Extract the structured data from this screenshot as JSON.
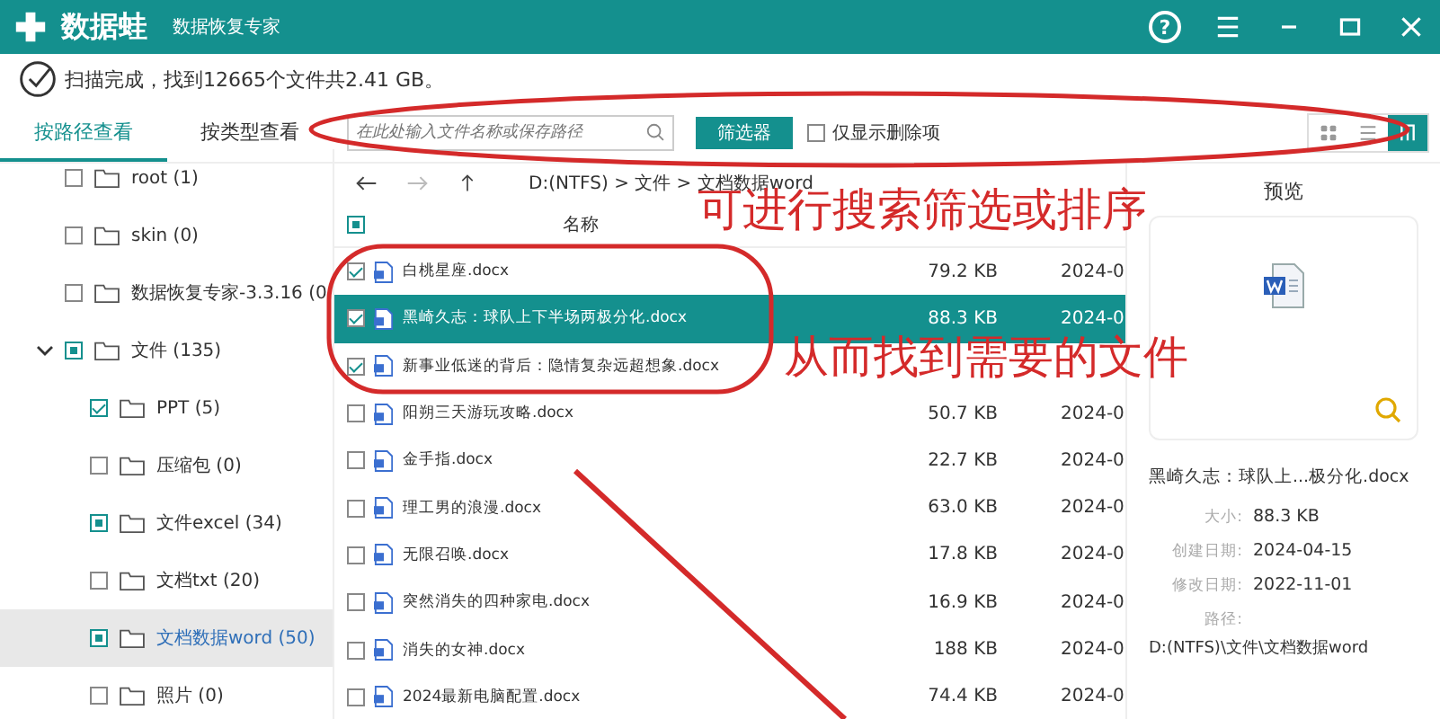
{
  "window": {
    "logo": "数据蛙",
    "subtitle": "数据恢复专家",
    "help": "?"
  },
  "status": "扫描完成，找到12665个文件共2.41 GB。",
  "tabs": [
    {
      "label": "按路径查看",
      "selected": true
    },
    {
      "label": "按类型查看",
      "selected": false
    }
  ],
  "search": {
    "placeholder": "在此处输入文件名称或保存路径"
  },
  "filter_button": "筛选器",
  "deleted_only": {
    "label": "仅显示删除项",
    "checked": false
  },
  "views": [
    {
      "kind": "grid",
      "selected": false
    },
    {
      "kind": "list",
      "selected": false
    },
    {
      "kind": "detail",
      "selected": true
    }
  ],
  "path": "D:(NTFS) > 文件 > 文档数据word",
  "tree": [
    {
      "label": "root (1)",
      "checked": false,
      "partial": false,
      "selected": false
    },
    {
      "label": "skin (0)",
      "checked": false,
      "partial": false,
      "selected": false
    },
    {
      "label": "数据恢复专家-3.3.16 (0",
      "checked": false,
      "partial": false,
      "selected": false
    },
    {
      "label": "文件 (135)",
      "checked": true,
      "partial": true,
      "selected": false,
      "expanded": true,
      "children": [
        {
          "label": "PPT (5)",
          "checked": true,
          "partial": false,
          "selected": false
        },
        {
          "label": "压缩包 (0)",
          "checked": false,
          "partial": false,
          "selected": false
        },
        {
          "label": "文件excel (34)",
          "checked": true,
          "partial": true,
          "selected": false
        },
        {
          "label": "文档txt (20)",
          "checked": false,
          "partial": false,
          "selected": false
        },
        {
          "label": "文档数据word (50)",
          "checked": true,
          "partial": true,
          "selected": true
        },
        {
          "label": "照片 (0)",
          "checked": false,
          "partial": false,
          "selected": false
        }
      ]
    }
  ],
  "table": {
    "all_checked": true,
    "all_partial": true,
    "columns": [
      "名称"
    ],
    "rows": [
      {
        "name": "白桃星座.docx",
        "size": "79.2 KB",
        "date": "2024-0",
        "checked": true,
        "selected": false
      },
      {
        "name": "黑崎久志：球队上下半场两极分化.docx",
        "size": "88.3 KB",
        "date": "2024-0",
        "checked": true,
        "selected": true
      },
      {
        "name": "新事业低迷的背后：隐情复杂远超想象.docx",
        "checked": true,
        "selected": false
      },
      {
        "name": "阳朔三天游玩攻略.docx",
        "size": "50.7 KB",
        "date": "2024-0",
        "checked": false,
        "selected": false
      },
      {
        "name": "金手指.docx",
        "size": "22.7 KB",
        "date": "2024-0",
        "checked": false,
        "selected": false
      },
      {
        "name": "理工男的浪漫.docx",
        "size": "63.0 KB",
        "date": "2024-0",
        "checked": false,
        "selected": false
      },
      {
        "name": "无限召唤.docx",
        "size": "17.8 KB",
        "date": "2024-0",
        "checked": false,
        "selected": false
      },
      {
        "name": "突然消失的四种家电.docx",
        "size": "16.9 KB",
        "date": "2024-0",
        "checked": false,
        "selected": false
      },
      {
        "name": "消失的女神.docx",
        "size": "188 KB",
        "date": "2024-0",
        "checked": false,
        "selected": false
      },
      {
        "name": "2024最新电脑配置.docx",
        "size": "74.4 KB",
        "date": "2024-0",
        "checked": false,
        "selected": false
      }
    ]
  },
  "preview": {
    "title": "预览",
    "file_name": "黑崎久志：球队上...极分化.docx",
    "fields": [
      {
        "label": "大小:",
        "value": "88.3 KB"
      },
      {
        "label": "创建日期:",
        "value": "2024-04-15"
      },
      {
        "label": "修改日期:",
        "value": "2022-11-01"
      },
      {
        "label": "路径:",
        "value": "D:(NTFS)\\文件\\文档数据word"
      }
    ]
  },
  "annotations": [
    "可进行搜索筛选或排序",
    "从而找到需要的文件"
  ]
}
